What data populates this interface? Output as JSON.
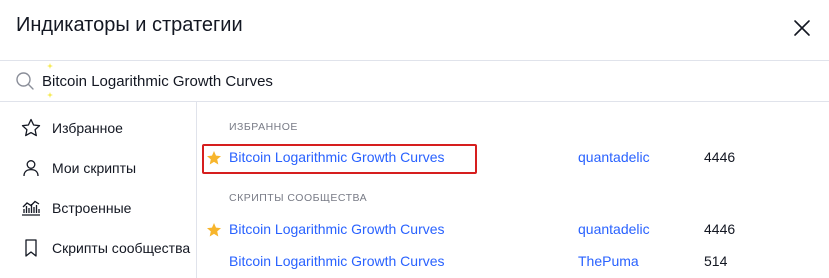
{
  "dialog": {
    "title": "Индикаторы и стратегии",
    "close_icon": "close-icon"
  },
  "search": {
    "value": "Bitcoin Logarithmic Growth Curves",
    "icon": "search-icon"
  },
  "sidebar": {
    "items": [
      {
        "label": "Избранное",
        "icon": "star-outline-icon"
      },
      {
        "label": "Мои скрипты",
        "icon": "user-icon"
      },
      {
        "label": "Встроенные",
        "icon": "chart-icon"
      },
      {
        "label": "Скрипты сообщества",
        "icon": "bookmark-icon"
      }
    ]
  },
  "sections": {
    "favorites": {
      "header": "ИЗБРАННОЕ",
      "rows": [
        {
          "name": "Bitcoin Logarithmic Growth Curves",
          "author": "quantadelic",
          "likes": "4446",
          "starred": true
        }
      ]
    },
    "community": {
      "header": "СКРИПТЫ СООБЩЕСТВА",
      "rows": [
        {
          "name": "Bitcoin Logarithmic Growth Curves",
          "author": "quantadelic",
          "likes": "4446",
          "starred": true
        },
        {
          "name": "Bitcoin Logarithmic Growth Curves",
          "author": "ThePuma",
          "likes": "514",
          "starred": false
        }
      ]
    }
  },
  "colors": {
    "accent": "#2962ff",
    "star": "#f7b52c",
    "highlight": "#d61e1e",
    "text": "#131722",
    "muted": "#787b86"
  }
}
